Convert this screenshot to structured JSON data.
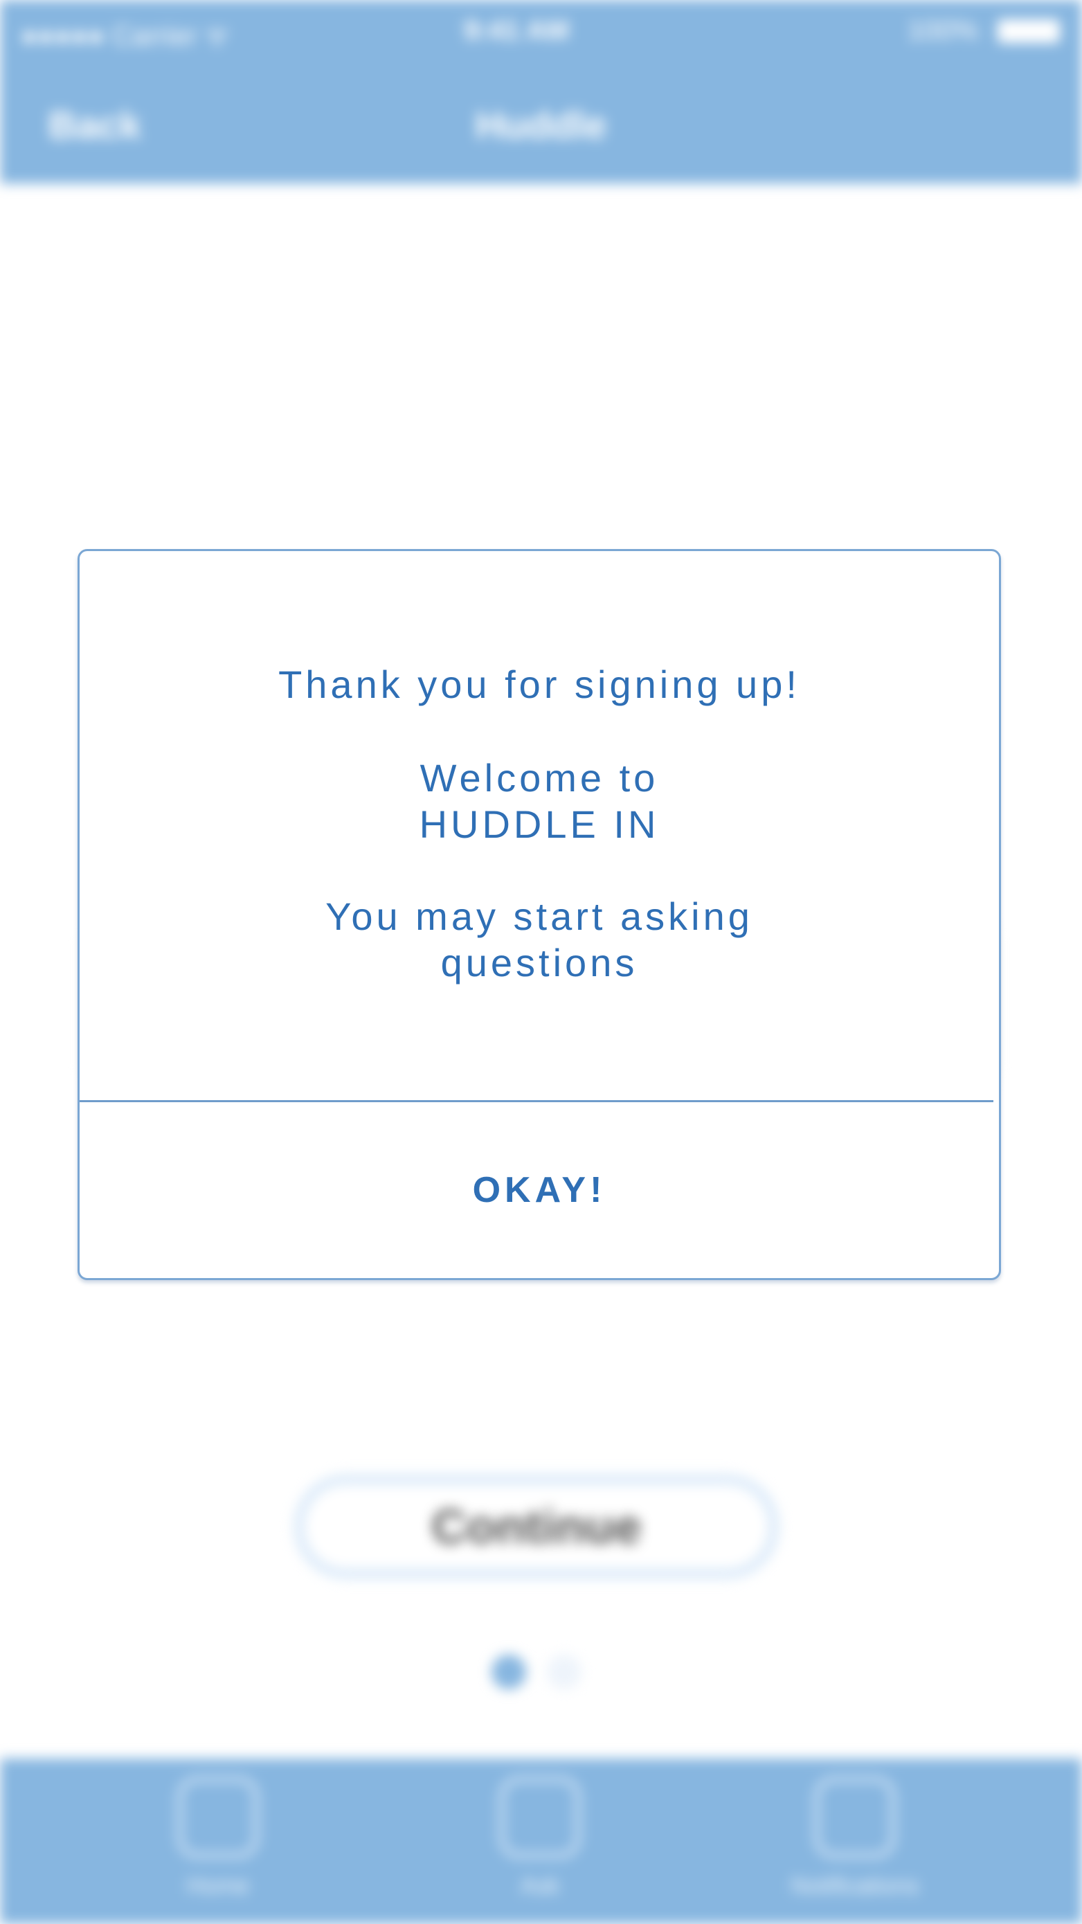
{
  "status_bar": {
    "carrier": "●●●●● Carrier ᯤ",
    "time": "9:41 AM",
    "battery_percent": "100%"
  },
  "nav_bar": {
    "back_label": "Back",
    "title": "Huddle"
  },
  "background": {
    "continue_label": "Continue",
    "page_dots": {
      "count": 2,
      "active_index": 0
    },
    "tabs": [
      {
        "label": "Home",
        "icon": "home-icon"
      },
      {
        "label": "Ask",
        "icon": "question-icon"
      },
      {
        "label": "Notifications",
        "icon": "bell-icon"
      }
    ]
  },
  "dialog": {
    "lines": [
      "Thank you for signing up!",
      "Welcome to",
      "HUDDLE IN",
      "You may start asking",
      "questions"
    ],
    "button_label": "OKAY!"
  },
  "colors": {
    "brand_blue": "#87b6e0",
    "dialog_text": "#2f6fb5",
    "dialog_border": "#7ba7d4"
  }
}
